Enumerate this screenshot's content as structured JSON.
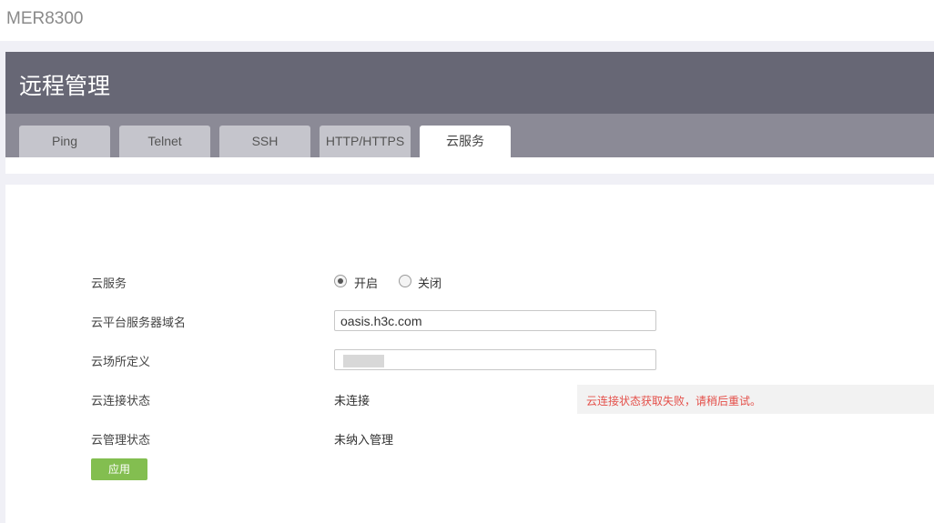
{
  "app": {
    "device_name": "MER8300"
  },
  "header": {
    "title": "远程管理"
  },
  "tabs": [
    {
      "label": "Ping",
      "active": false
    },
    {
      "label": "Telnet",
      "active": false
    },
    {
      "label": "SSH",
      "active": false
    },
    {
      "label": "HTTP/HTTPS",
      "active": false
    },
    {
      "label": "云服务",
      "active": true
    }
  ],
  "form": {
    "cloud_service": {
      "label": "云服务",
      "options": [
        {
          "label": "开启",
          "checked": true
        },
        {
          "label": "关闭",
          "checked": false
        }
      ]
    },
    "server_domain": {
      "label": "云平台服务器域名",
      "value": "oasis.h3c.com"
    },
    "site_definition": {
      "label": "云场所定义",
      "value": ""
    },
    "connection_status": {
      "label": "云连接状态",
      "value": "未连接",
      "error": "云连接状态获取失败，请稍后重试。"
    },
    "management_status": {
      "label": "云管理状态",
      "value": "未纳入管理"
    },
    "apply_label": "应用"
  },
  "colors": {
    "header_bg": "#676775",
    "tabbar_bg": "#8b8a96",
    "apply_green": "#83be50",
    "error_red": "#e4504a"
  }
}
